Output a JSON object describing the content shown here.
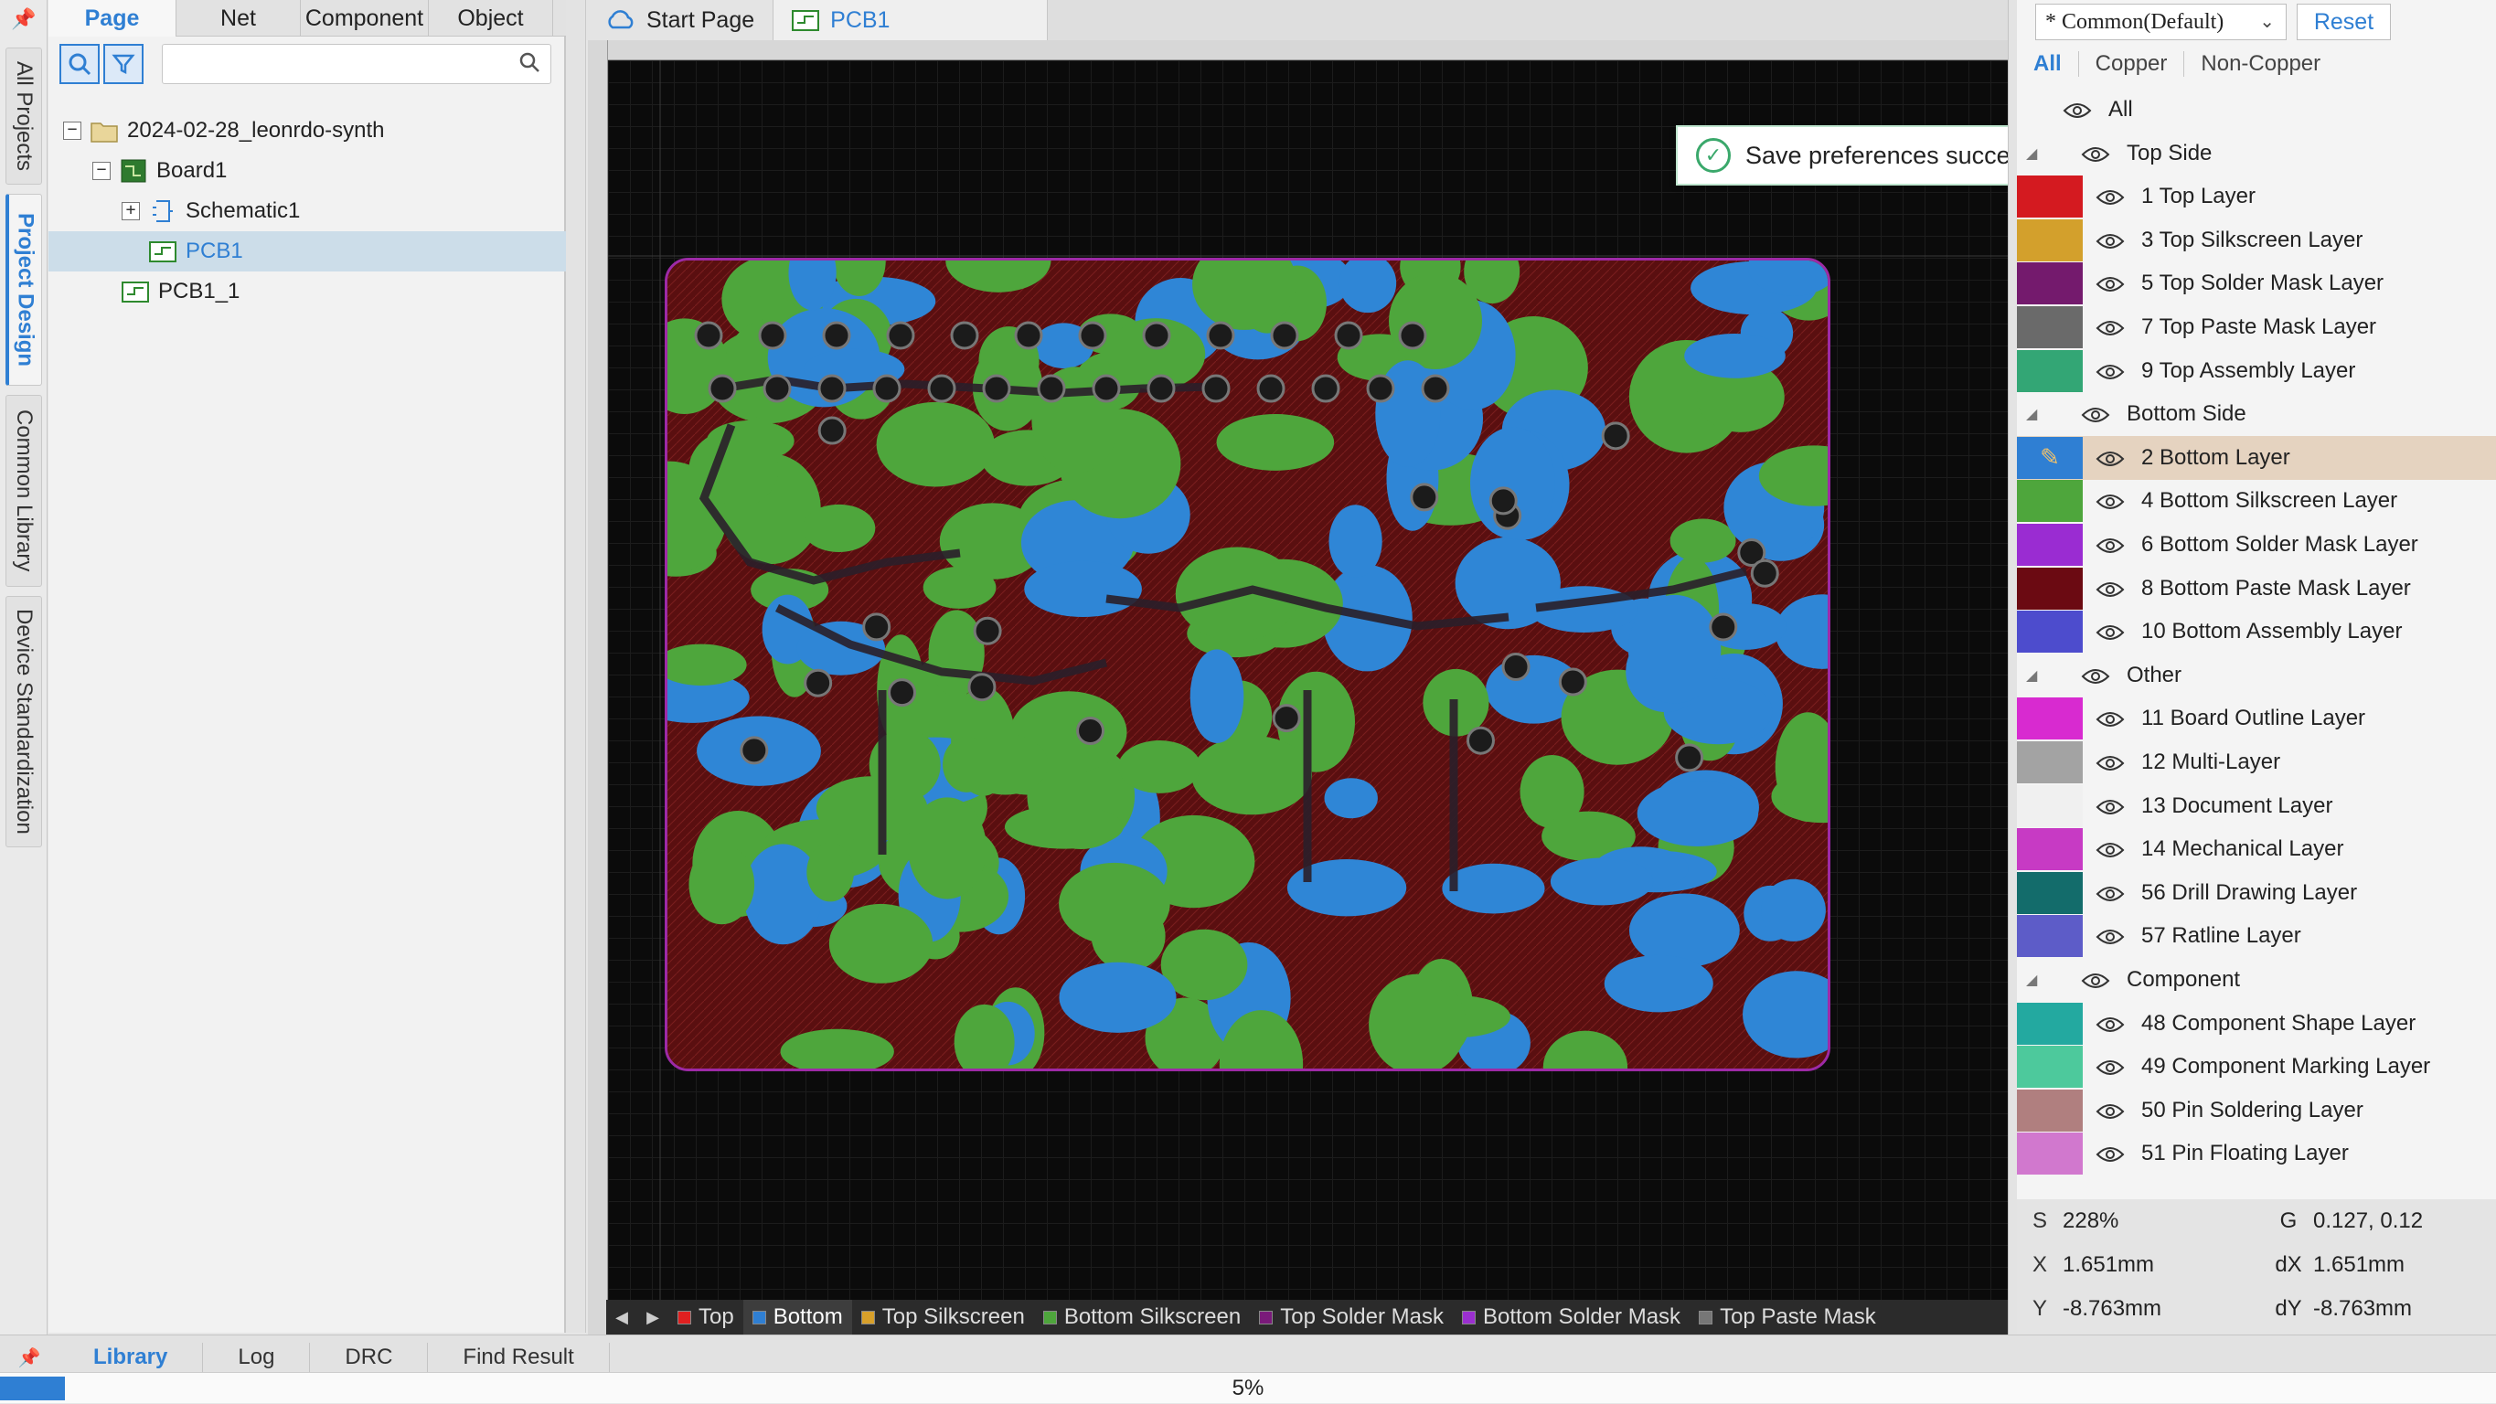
{
  "rail": {
    "tabs": [
      "All Projects",
      "Project Design",
      "Common Library",
      "Device Standardization"
    ],
    "active": "Project Design"
  },
  "left_panel": {
    "tabs": [
      "Page",
      "Net",
      "Component",
      "Object"
    ],
    "active_tab": "Page",
    "search_placeholder": "",
    "tree": [
      {
        "label": "2024-02-28_leonrdo-synth",
        "type": "folder"
      },
      {
        "label": "Board1",
        "type": "board"
      },
      {
        "label": "Schematic1",
        "type": "schematic"
      },
      {
        "label": "PCB1",
        "type": "pcb",
        "selected": true
      },
      {
        "label": "PCB1_1",
        "type": "pcb"
      }
    ]
  },
  "doc_tabs": [
    {
      "label": "Start Page",
      "icon": "cloud-icon"
    },
    {
      "label": "PCB1",
      "icon": "pcb-icon",
      "active": true
    }
  ],
  "toast": {
    "message": "Save preferences successfully!"
  },
  "layer_bar": [
    {
      "label": "Top",
      "color": "#e02020"
    },
    {
      "label": "Bottom",
      "color": "#2f7fd3",
      "active": true
    },
    {
      "label": "Top Silkscreen",
      "color": "#d8a02a"
    },
    {
      "label": "Bottom Silkscreen",
      "color": "#4ea63c"
    },
    {
      "label": "Top Solder Mask",
      "color": "#7a1a7a"
    },
    {
      "label": "Bottom Solder Mask",
      "color": "#9b2fd0"
    },
    {
      "label": "Top Paste Mask",
      "color": "#777777"
    }
  ],
  "right_panel": {
    "preset": "* Common(Default)",
    "reset_label": "Reset",
    "filters": [
      "All",
      "Copper",
      "Non-Copper"
    ],
    "active_filter": "All",
    "layers": [
      {
        "label": "All",
        "kind": "all"
      },
      {
        "label": "Top Side",
        "kind": "group"
      },
      {
        "label": "1 Top Layer",
        "color": "#d41a20"
      },
      {
        "label": "3 Top Silkscreen Layer",
        "color": "#d3a02c"
      },
      {
        "label": "5 Top Solder Mask Layer",
        "color": "#741a6d"
      },
      {
        "label": "7 Top Paste Mask Layer",
        "color": "#6a6a6a"
      },
      {
        "label": "9 Top Assembly Layer",
        "color": "#33a675"
      },
      {
        "label": "Bottom Side",
        "kind": "group"
      },
      {
        "label": "2 Bottom Layer",
        "color": "#2f7fd3",
        "selected": true,
        "editing": true
      },
      {
        "label": "4 Bottom Silkscreen Layer",
        "color": "#4ea63c"
      },
      {
        "label": "6 Bottom Solder Mask Layer",
        "color": "#9a2cd2"
      },
      {
        "label": "8 Bottom Paste Mask Layer",
        "color": "#6b0a12"
      },
      {
        "label": "10 Bottom Assembly Layer",
        "color": "#4d4ccd"
      },
      {
        "label": "Other",
        "kind": "group"
      },
      {
        "label": "11 Board Outline Layer",
        "color": "#d82ad0"
      },
      {
        "label": "12 Multi-Layer",
        "color": "#a3a3a3"
      },
      {
        "label": "13 Document Layer",
        "color": "#f0f0f0"
      },
      {
        "label": "14 Mechanical Layer",
        "color": "#c73ac4"
      },
      {
        "label": "56 Drill Drawing Layer",
        "color": "#136c6b"
      },
      {
        "label": "57 Ratline Layer",
        "color": "#5d5cc8"
      },
      {
        "label": "Component",
        "kind": "group"
      },
      {
        "label": "48 Component Shape Layer",
        "color": "#23a9a0"
      },
      {
        "label": "49 Component Marking Layer",
        "color": "#4dc99c"
      },
      {
        "label": "50 Pin Soldering Layer",
        "color": "#b07f7f"
      },
      {
        "label": "51 Pin Floating Layer",
        "color": "#d178ce"
      }
    ]
  },
  "status": {
    "s_label": "S",
    "s_value": "228%",
    "g_label": "G",
    "g_value": "0.127, 0.12",
    "x_label": "X",
    "x_value": "1.651mm",
    "dx_label": "dX",
    "dx_value": "1.651mm",
    "y_label": "Y",
    "y_value": "-8.763mm",
    "dy_label": "dY",
    "dy_value": "-8.763mm"
  },
  "bottom_tabs": [
    "Library",
    "Log",
    "DRC",
    "Find Result"
  ],
  "bottom_active": "Library",
  "progress": {
    "label": "5%",
    "fraction": 0.05
  }
}
